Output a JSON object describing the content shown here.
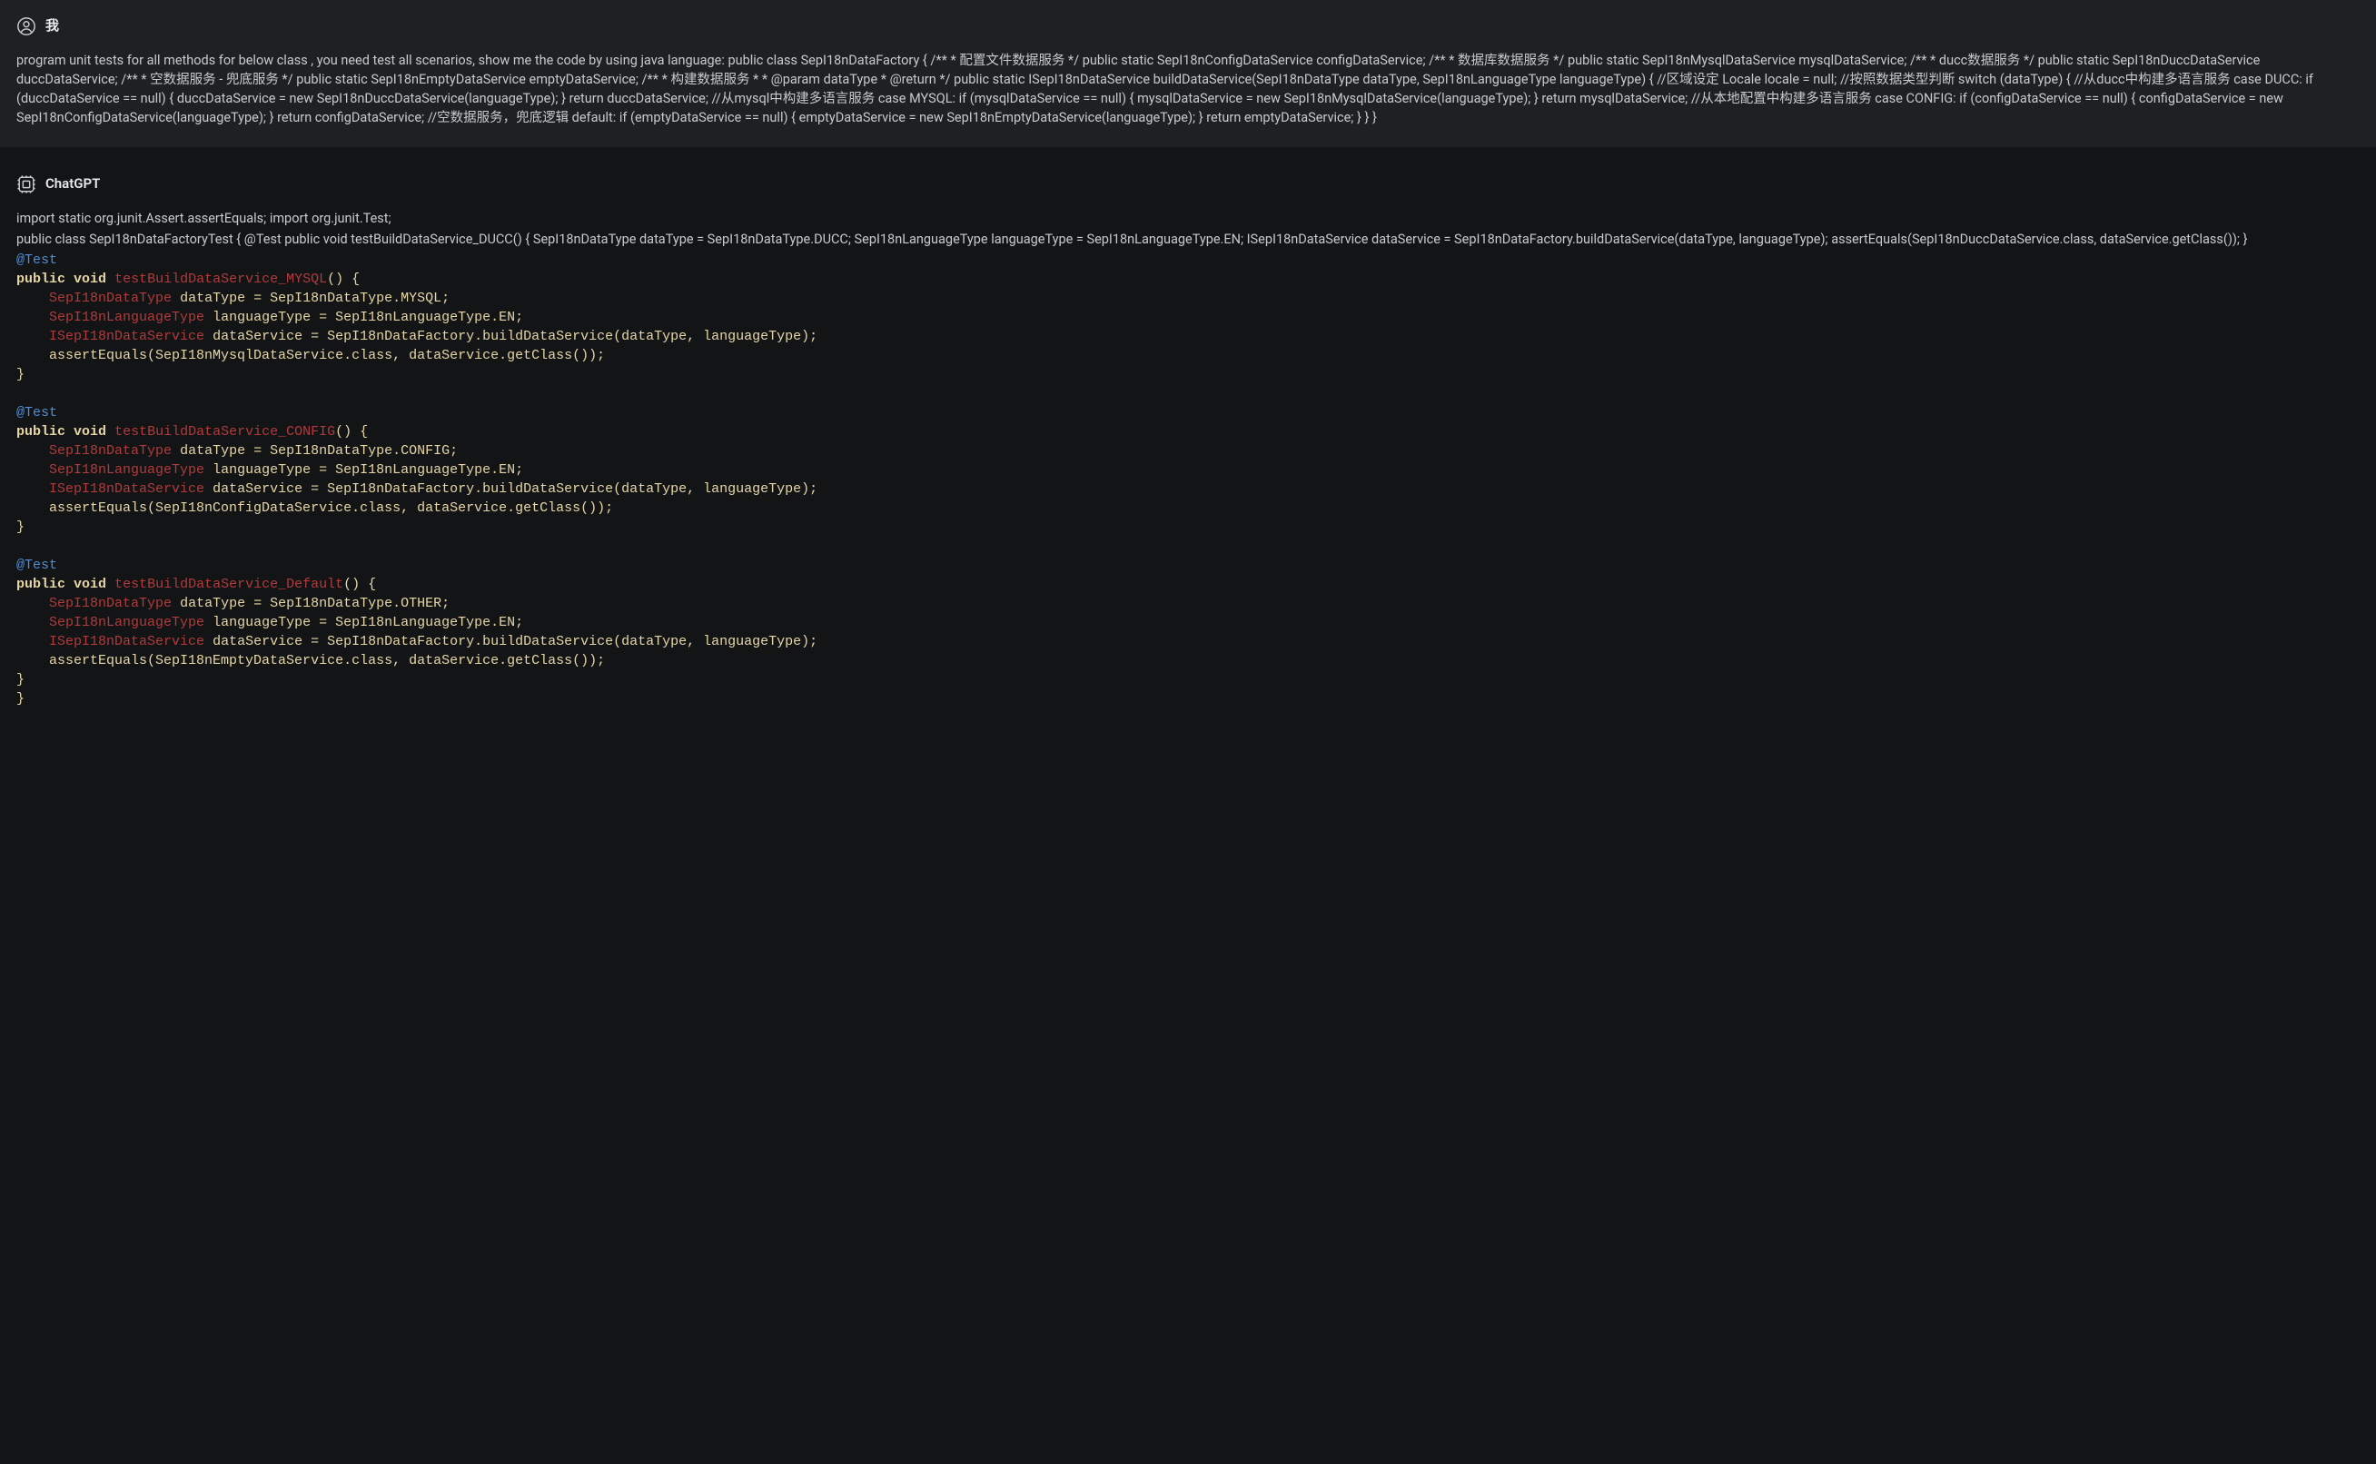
{
  "user": {
    "name": "我",
    "body": "program unit tests for all methods for below class , you need test all scenarios, show me the code by using java language: public class SepI18nDataFactory { /** * 配置文件数据服务 */ public static SepI18nConfigDataService configDataService; /** * 数据库数据服务 */ public static SepI18nMysqlDataService mysqlDataService; /** * ducc数据服务 */ public static SepI18nDuccDataService duccDataService; /** * 空数据服务 - 兜底服务 */ public static SepI18nEmptyDataService emptyDataService; /** * 构建数据服务 * * @param dataType * @return */ public static ISepI18nDataService buildDataService(SepI18nDataType dataType, SepI18nLanguageType languageType) { //区域设定 Locale locale = null; //按照数据类型判断 switch (dataType) { //从ducc中构建多语言服务 case DUCC: if (duccDataService == null) { duccDataService = new SepI18nDuccDataService(languageType); } return duccDataService; //从mysql中构建多语言服务 case MYSQL: if (mysqlDataService == null) { mysqlDataService = new SepI18nMysqlDataService(languageType); } return mysqlDataService; //从本地配置中构建多语言服务 case CONFIG: if (configDataService == null) { configDataService = new SepI18nConfigDataService(languageType); } return configDataService; //空数据服务，兜底逻辑 default: if (emptyDataService == null) { emptyDataService = new SepI18nEmptyDataService(languageType); } return emptyDataService; } } }"
  },
  "assistant": {
    "name": "ChatGPT",
    "para1": "import static org.junit.Assert.assertEquals; import org.junit.Test;",
    "para2": "public class SepI18nDataFactoryTest { @Test public void testBuildDataService_DUCC() { SepI18nDataType dataType = SepI18nDataType.DUCC; SepI18nLanguageType languageType = SepI18nLanguageType.EN; ISepI18nDataService dataService = SepI18nDataFactory.buildDataService(dataType, languageType); assertEquals(SepI18nDuccDataService.class, dataService.getClass()); }",
    "code_tokens": [
      {
        "c": "anno",
        "t": "@Test"
      },
      {
        "c": "",
        "t": "\n"
      },
      {
        "c": "kw",
        "t": "public"
      },
      {
        "c": "",
        "t": " "
      },
      {
        "c": "kw",
        "t": "void"
      },
      {
        "c": "",
        "t": " "
      },
      {
        "c": "mname",
        "t": "testBuildDataService_MYSQL"
      },
      {
        "c": "normal",
        "t": "() {"
      },
      {
        "c": "",
        "t": "\n"
      },
      {
        "c": "",
        "t": "    "
      },
      {
        "c": "type",
        "t": "SepI18nDataType"
      },
      {
        "c": "",
        "t": " "
      },
      {
        "c": "normal",
        "t": "dataType = SepI18nDataType.MYSQL;"
      },
      {
        "c": "",
        "t": "\n"
      },
      {
        "c": "",
        "t": "    "
      },
      {
        "c": "type",
        "t": "SepI18nLanguageType"
      },
      {
        "c": "",
        "t": " "
      },
      {
        "c": "normal",
        "t": "languageType = SepI18nLanguageType.EN;"
      },
      {
        "c": "",
        "t": "\n"
      },
      {
        "c": "",
        "t": "    "
      },
      {
        "c": "type",
        "t": "ISepI18nDataService"
      },
      {
        "c": "",
        "t": " "
      },
      {
        "c": "normal",
        "t": "dataService = SepI18nDataFactory.buildDataService(dataType, languageType);"
      },
      {
        "c": "",
        "t": "\n"
      },
      {
        "c": "",
        "t": "    "
      },
      {
        "c": "normal",
        "t": "assertEquals(SepI18nMysqlDataService.class, dataService.getClass());"
      },
      {
        "c": "",
        "t": "\n"
      },
      {
        "c": "normal",
        "t": "}"
      },
      {
        "c": "",
        "t": "\n"
      },
      {
        "c": "",
        "t": "\n"
      },
      {
        "c": "anno",
        "t": "@Test"
      },
      {
        "c": "",
        "t": "\n"
      },
      {
        "c": "kw",
        "t": "public"
      },
      {
        "c": "",
        "t": " "
      },
      {
        "c": "kw",
        "t": "void"
      },
      {
        "c": "",
        "t": " "
      },
      {
        "c": "mname",
        "t": "testBuildDataService_CONFIG"
      },
      {
        "c": "normal",
        "t": "() {"
      },
      {
        "c": "",
        "t": "\n"
      },
      {
        "c": "",
        "t": "    "
      },
      {
        "c": "type",
        "t": "SepI18nDataType"
      },
      {
        "c": "",
        "t": " "
      },
      {
        "c": "normal",
        "t": "dataType = SepI18nDataType.CONFIG;"
      },
      {
        "c": "",
        "t": "\n"
      },
      {
        "c": "",
        "t": "    "
      },
      {
        "c": "type",
        "t": "SepI18nLanguageType"
      },
      {
        "c": "",
        "t": " "
      },
      {
        "c": "normal",
        "t": "languageType = SepI18nLanguageType.EN;"
      },
      {
        "c": "",
        "t": "\n"
      },
      {
        "c": "",
        "t": "    "
      },
      {
        "c": "type",
        "t": "ISepI18nDataService"
      },
      {
        "c": "",
        "t": " "
      },
      {
        "c": "normal",
        "t": "dataService = SepI18nDataFactory.buildDataService(dataType, languageType);"
      },
      {
        "c": "",
        "t": "\n"
      },
      {
        "c": "",
        "t": "    "
      },
      {
        "c": "normal",
        "t": "assertEquals(SepI18nConfigDataService.class, dataService.getClass());"
      },
      {
        "c": "",
        "t": "\n"
      },
      {
        "c": "normal",
        "t": "}"
      },
      {
        "c": "",
        "t": "\n"
      },
      {
        "c": "",
        "t": "\n"
      },
      {
        "c": "anno",
        "t": "@Test"
      },
      {
        "c": "",
        "t": "\n"
      },
      {
        "c": "kw",
        "t": "public"
      },
      {
        "c": "",
        "t": " "
      },
      {
        "c": "kw",
        "t": "void"
      },
      {
        "c": "",
        "t": " "
      },
      {
        "c": "mname",
        "t": "testBuildDataService_Default"
      },
      {
        "c": "normal",
        "t": "() {"
      },
      {
        "c": "",
        "t": "\n"
      },
      {
        "c": "",
        "t": "    "
      },
      {
        "c": "type",
        "t": "SepI18nDataType"
      },
      {
        "c": "",
        "t": " "
      },
      {
        "c": "normal",
        "t": "dataType = SepI18nDataType.OTHER;"
      },
      {
        "c": "",
        "t": "\n"
      },
      {
        "c": "",
        "t": "    "
      },
      {
        "c": "type",
        "t": "SepI18nLanguageType"
      },
      {
        "c": "",
        "t": " "
      },
      {
        "c": "normal",
        "t": "languageType = SepI18nLanguageType.EN;"
      },
      {
        "c": "",
        "t": "\n"
      },
      {
        "c": "",
        "t": "    "
      },
      {
        "c": "type",
        "t": "ISepI18nDataService"
      },
      {
        "c": "",
        "t": " "
      },
      {
        "c": "normal",
        "t": "dataService = SepI18nDataFactory.buildDataService(dataType, languageType);"
      },
      {
        "c": "",
        "t": "\n"
      },
      {
        "c": "",
        "t": "    "
      },
      {
        "c": "normal",
        "t": "assertEquals(SepI18nEmptyDataService.class, dataService.getClass());"
      },
      {
        "c": "",
        "t": "\n"
      },
      {
        "c": "normal",
        "t": "}"
      },
      {
        "c": "",
        "t": "\n"
      },
      {
        "c": "normal",
        "t": "}"
      }
    ]
  }
}
